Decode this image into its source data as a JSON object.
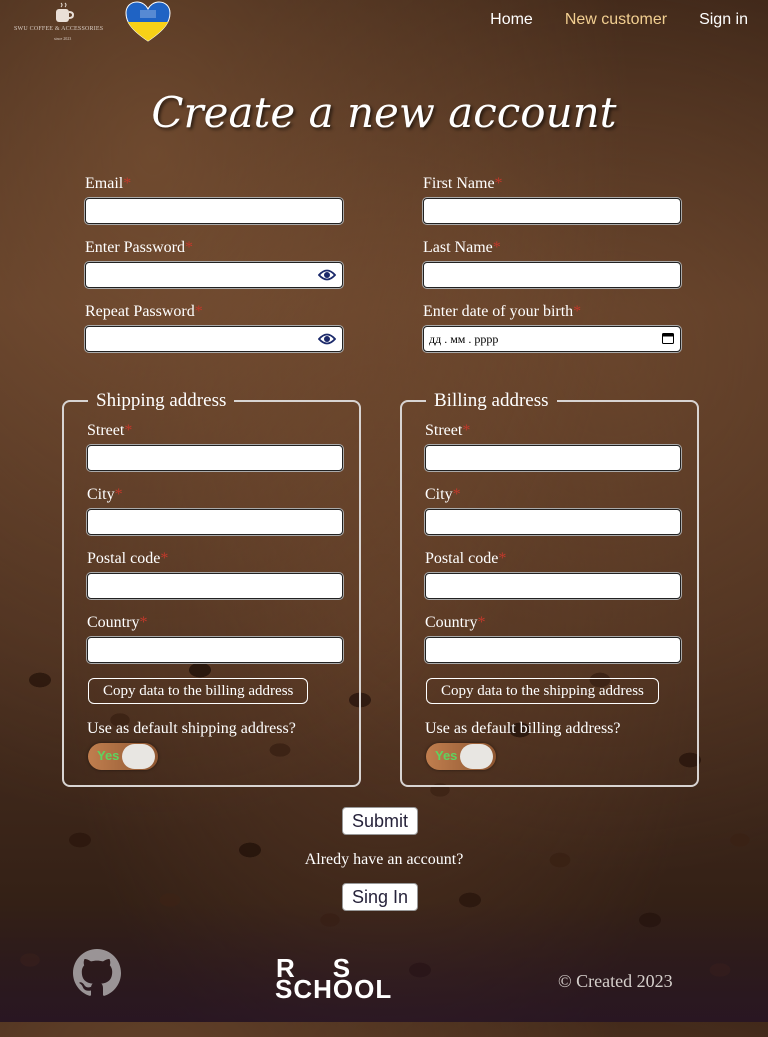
{
  "header": {
    "logo_text": "SWU COFFEE & ACCESSORIES",
    "logo_sub": "since 2023",
    "nav": {
      "home": "Home",
      "new_customer": "New customer",
      "sign_in": "Sign in"
    },
    "accent_color": "#f2cf91"
  },
  "page_title": "Create a new account",
  "required_mark": "*",
  "fields": {
    "email": {
      "label": "Email",
      "value": ""
    },
    "first_name": {
      "label": "First Name",
      "value": ""
    },
    "password": {
      "label": "Enter Password",
      "value": "",
      "icon": "eye-icon"
    },
    "last_name": {
      "label": "Last Name",
      "value": ""
    },
    "repeat_password": {
      "label": "Repeat Password",
      "value": "",
      "icon": "eye-icon"
    },
    "birth_date": {
      "label": "Enter date of your birth",
      "placeholder": "дд . мм . рррр",
      "icon": "calendar-icon"
    }
  },
  "shipping": {
    "legend": "Shipping address",
    "street": "Street",
    "city": "City",
    "postal": "Postal code",
    "country": "Country",
    "copy_button": "Copy data to the billing address",
    "default_question": "Use as default shipping address?",
    "toggle_label": "Yes"
  },
  "billing": {
    "legend": "Billing address",
    "street": "Street",
    "city": "City",
    "postal": "Postal code",
    "country": "Country",
    "copy_button": "Copy data to the shipping address",
    "default_question": "Use as default billing address?",
    "toggle_label": "Yes"
  },
  "submit_button": "Submit",
  "already_text": "Alredy have an account?",
  "signin_button": "Sing In",
  "footer": {
    "rs_top": "RS",
    "rs_bottom": "SCHOOL",
    "copyright": "©  Created 2023"
  }
}
